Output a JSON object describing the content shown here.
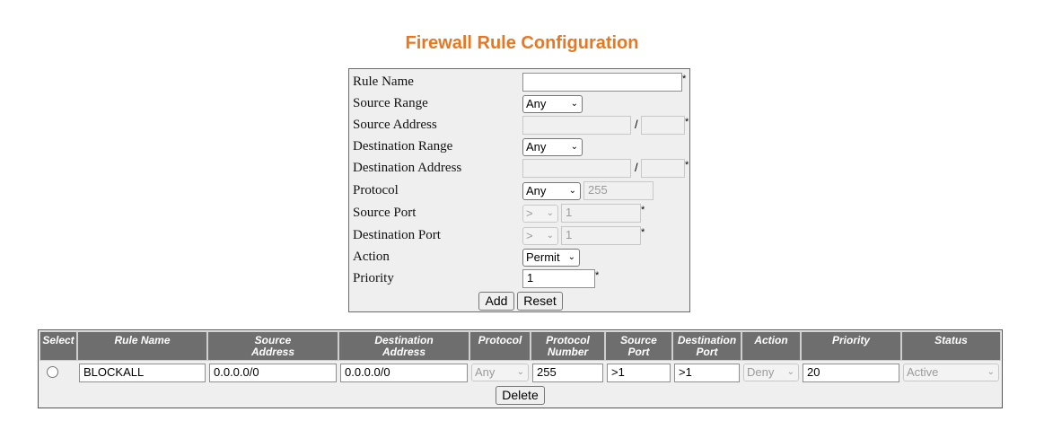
{
  "title": "Firewall Rule Configuration",
  "form": {
    "rule_name": {
      "label": "Rule Name",
      "value": "",
      "required": "*"
    },
    "source_range": {
      "label": "Source Range",
      "selected": "Any"
    },
    "source_address": {
      "label": "Source Address",
      "ip": "",
      "mask": "",
      "separator": "/",
      "required": "*"
    },
    "destination_range": {
      "label": "Destination Range",
      "selected": "Any"
    },
    "destination_address": {
      "label": "Destination Address",
      "ip": "",
      "mask": "",
      "separator": "/",
      "required": "*"
    },
    "protocol": {
      "label": "Protocol",
      "selected": "Any",
      "number": "255"
    },
    "source_port": {
      "label": "Source Port",
      "operator": ">",
      "value": "1",
      "required": "*"
    },
    "destination_port": {
      "label": "Destination Port",
      "operator": ">",
      "value": "1",
      "required": "*"
    },
    "action": {
      "label": "Action",
      "selected": "Permit"
    },
    "priority": {
      "label": "Priority",
      "value": "1",
      "required": "*"
    },
    "add_label": "Add",
    "reset_label": "Reset"
  },
  "table": {
    "headers": {
      "select": "Select",
      "rule_name": "Rule Name",
      "source_address": [
        "Source",
        "Address"
      ],
      "destination_address": [
        "Destination",
        "Address"
      ],
      "protocol": "Protocol",
      "protocol_number": [
        "Protocol",
        "Number"
      ],
      "source_port": [
        "Source",
        "Port"
      ],
      "destination_port": [
        "Destination",
        "Port"
      ],
      "action": "Action",
      "priority": "Priority",
      "status": "Status"
    },
    "rows": [
      {
        "rule_name": "BLOCKALL",
        "source_address": "0.0.0.0/0",
        "destination_address": "0.0.0.0/0",
        "protocol": "Any",
        "protocol_number": "255",
        "source_port": ">1",
        "destination_port": ">1",
        "action": "Deny",
        "priority": "20",
        "status": "Active"
      }
    ],
    "delete_label": "Delete"
  },
  "icons": {
    "dropdown": "chevron-down-icon"
  },
  "colors": {
    "title": "#e87722",
    "header_bg": "#6e6e6e",
    "panel_bg": "#efefef"
  }
}
